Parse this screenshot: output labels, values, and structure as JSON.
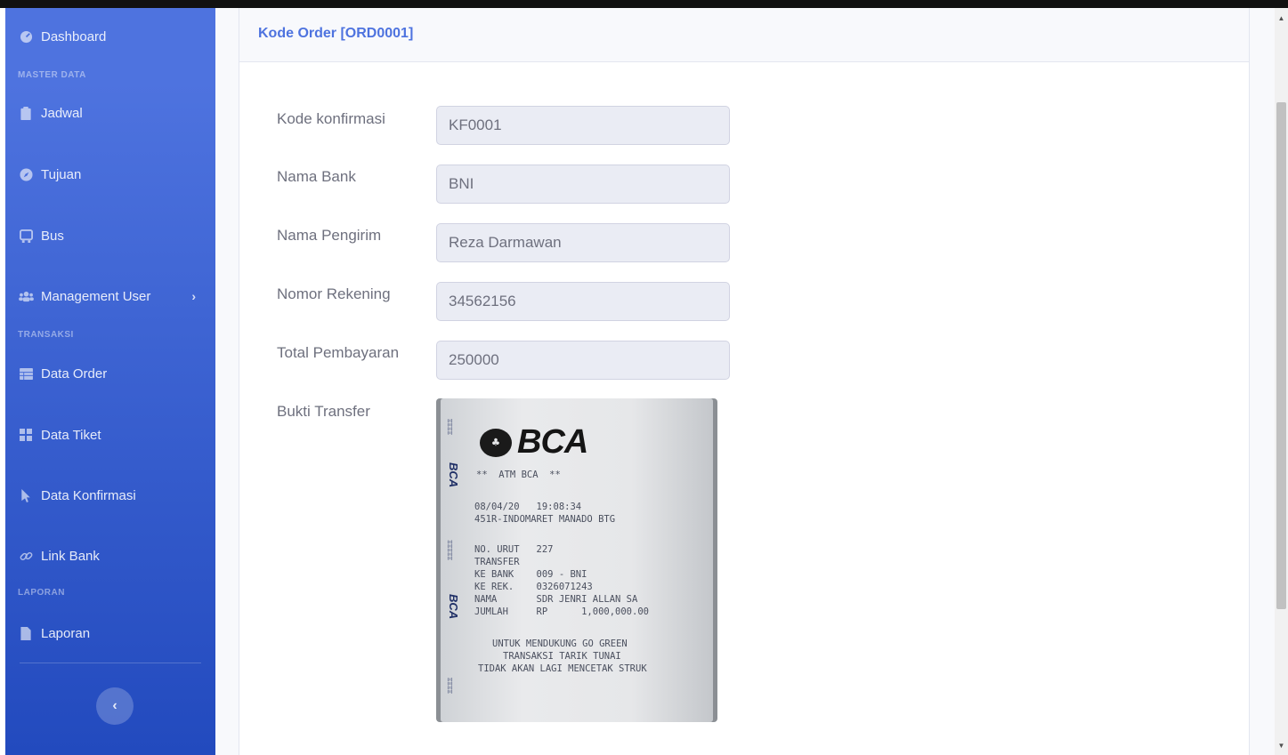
{
  "sidebar": {
    "items": [
      {
        "label": "Dashboard",
        "icon": "tachometer-icon"
      },
      {
        "label": "Jadwal",
        "icon": "clipboard-icon"
      },
      {
        "label": "Tujuan",
        "icon": "compass-icon"
      },
      {
        "label": "Bus",
        "icon": "bus-icon"
      },
      {
        "label": "Management User",
        "icon": "users-icon"
      },
      {
        "label": "Data Order",
        "icon": "table-icon"
      },
      {
        "label": "Data Tiket",
        "icon": "grid-icon"
      },
      {
        "label": "Data Konfirmasi",
        "icon": "cursor-icon"
      },
      {
        "label": "Link Bank",
        "icon": "link-icon"
      },
      {
        "label": "Laporan",
        "icon": "file-icon"
      }
    ],
    "headings": {
      "master_data": "MASTER DATA",
      "transaksi": "TRANSAKSI",
      "laporan": "LAPORAN"
    },
    "toggle_label": "‹"
  },
  "card": {
    "title": "Kode Order [ORD0001]"
  },
  "form": {
    "kode_konfirmasi": {
      "label": "Kode konfirmasi",
      "value": "KF0001"
    },
    "nama_bank": {
      "label": "Nama Bank",
      "value": "BNI"
    },
    "nama_pengirim": {
      "label": "Nama Pengirim",
      "value": "Reza Darmawan"
    },
    "nomor_rekening": {
      "label": "Nomor Rekening",
      "value": "34562156"
    },
    "total_pembayaran": {
      "label": "Total Pembayaran",
      "value": "250000"
    },
    "bukti_transfer": {
      "label": "Bukti Transfer"
    }
  },
  "receipt": {
    "logo": "BCA",
    "lines": [
      "**  ATM BCA  **",
      "08/04/20   19:08:34",
      "451R-INDOMARET MANADO BTG",
      "NO. URUT   227",
      "TRANSFER",
      "KE BANK    009 - BNI",
      "KE REK.    0326071243",
      "NAMA       SDR JENRI ALLAN SA",
      "JUMLAH     RP      1,000,000.00",
      "UNTUK MENDUKUNG GO GREEN",
      "TRANSAKSI TARIK TUNAI",
      "TIDAK AKAN LAGI MENCETAK STRUK"
    ]
  },
  "colors": {
    "sidebar_gradient_top": "#4e73df",
    "sidebar_gradient_bottom": "#224abe",
    "title_accent": "#4e73df",
    "input_bg": "#eaecf4"
  }
}
